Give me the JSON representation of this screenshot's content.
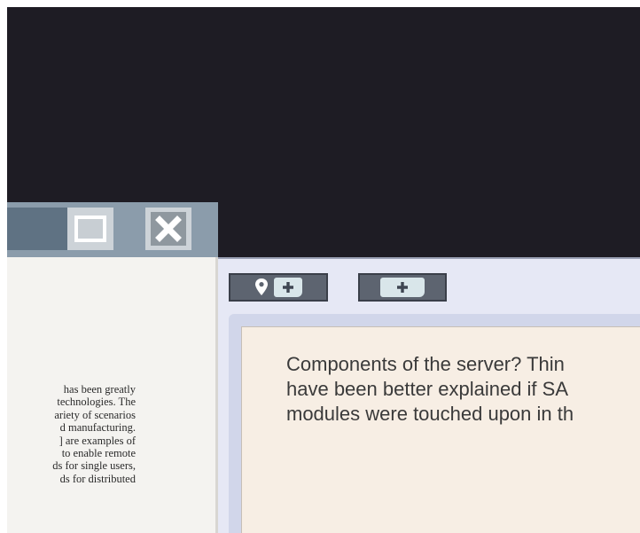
{
  "document_window": {
    "titlebar_buttons": {
      "maximize": "maximize-icon",
      "close": "close-icon"
    },
    "text_lines": [
      "has been greatly",
      "technologies. The",
      "ariety of scenarios",
      "d manufacturing.",
      "] are examples of",
      "to enable remote",
      "ds for single users,",
      "ds for distributed"
    ]
  },
  "editor_window": {
    "toolbar": [
      {
        "icon": "map-pin-icon",
        "secondary_icon": "plus-icon"
      },
      {
        "icon": "plus-icon"
      }
    ],
    "text_lines": [
      "Components of the server? Thin",
      "have been better explained if SA",
      "modules were touched upon in th"
    ]
  },
  "colors": {
    "desktop_background": "#1e1c24",
    "titlebar": "#8b9cab",
    "editor_background": "#f7eee4"
  }
}
